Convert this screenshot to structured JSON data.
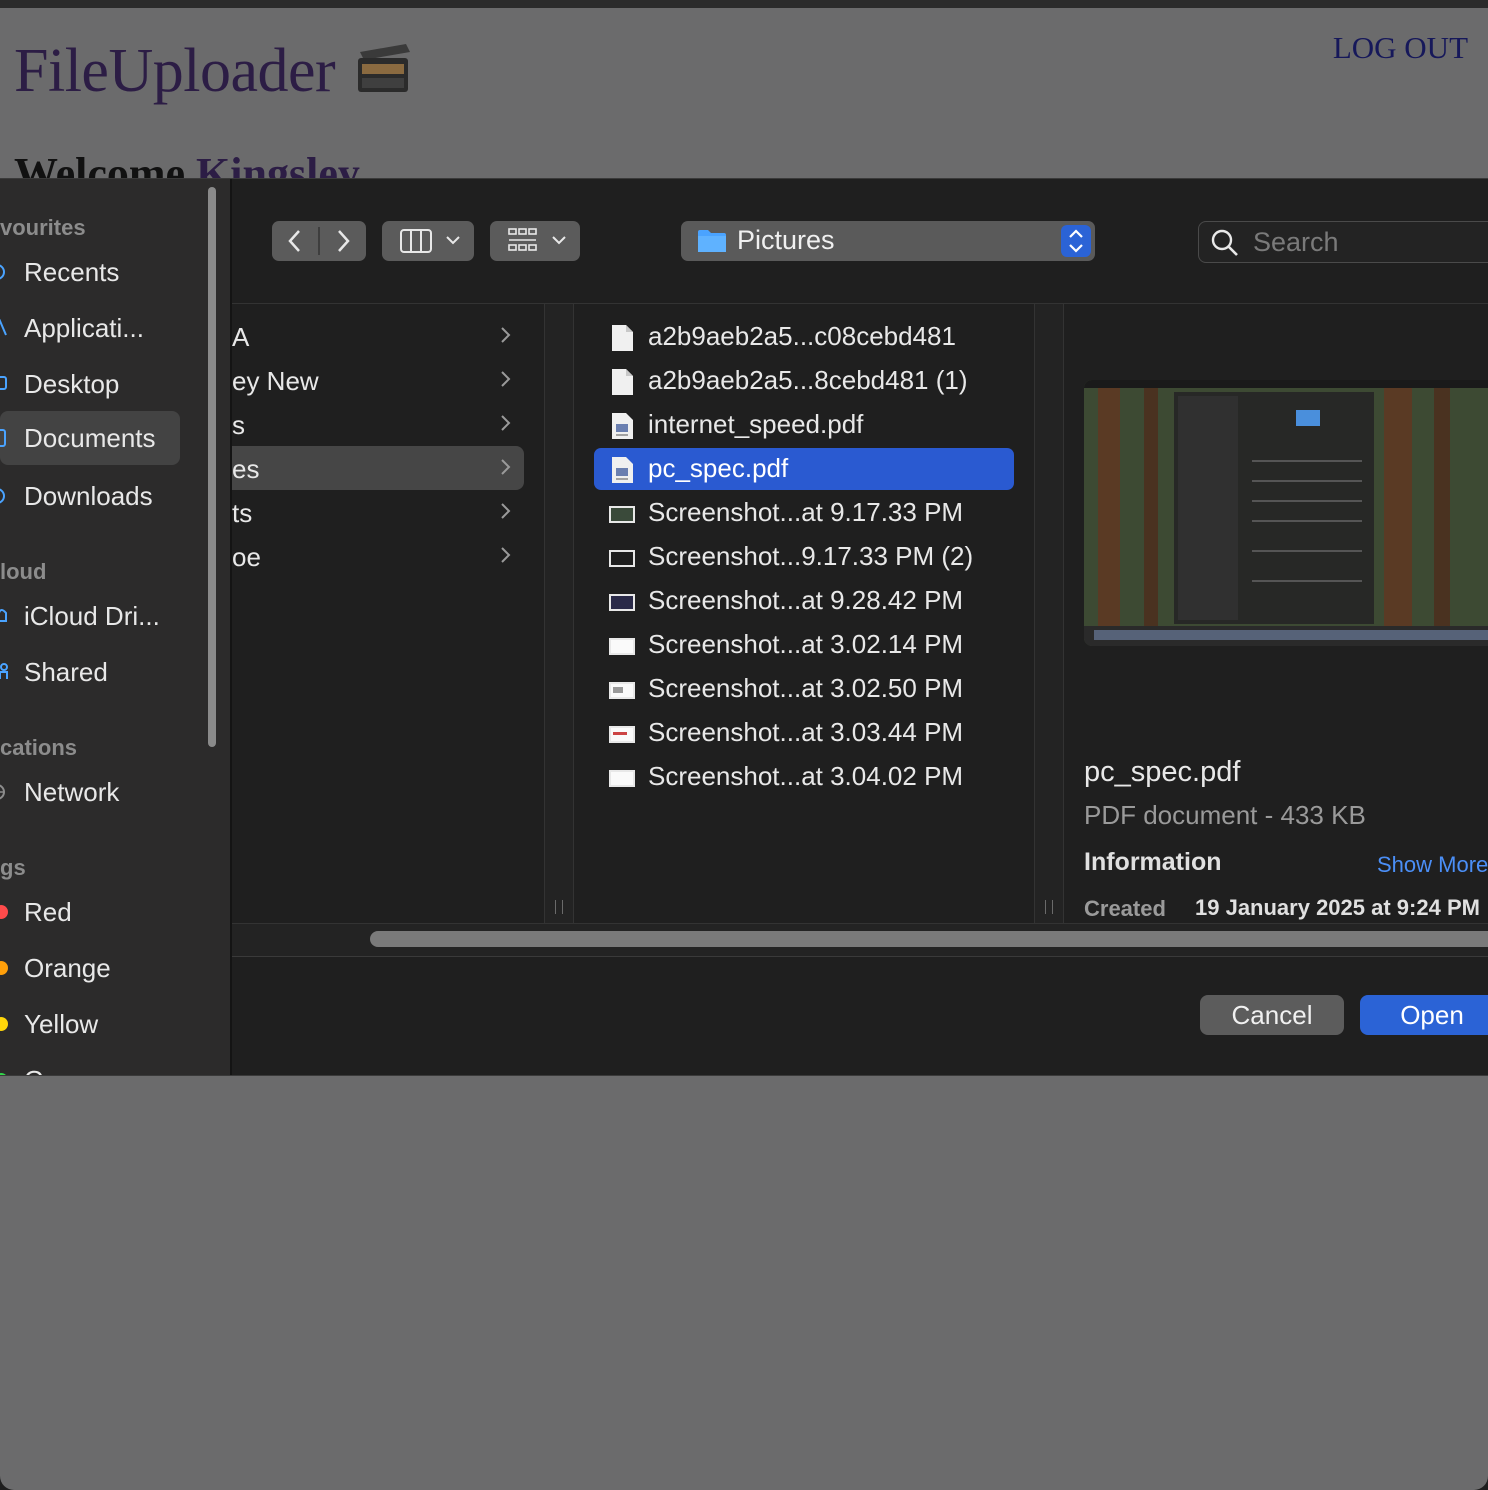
{
  "app": {
    "logo_text": "FileUploader",
    "logout_label": "LOG OUT",
    "welcome_prefix": "Welcome",
    "welcome_name": "Kingsley"
  },
  "sidebar": {
    "sections": [
      {
        "label": "vourites"
      },
      {
        "label": "loud"
      },
      {
        "label": "cations"
      },
      {
        "label": "gs"
      }
    ],
    "favourites": [
      {
        "label": "Recents",
        "icon": "clock-icon"
      },
      {
        "label": "Applicati...",
        "icon": "applications-icon"
      },
      {
        "label": "Desktop",
        "icon": "desktop-icon"
      },
      {
        "label": "Documents",
        "icon": "document-icon",
        "selected": true
      },
      {
        "label": "Downloads",
        "icon": "download-icon"
      }
    ],
    "icloud": [
      {
        "label": "iCloud Dri...",
        "icon": "cloud-icon"
      },
      {
        "label": "Shared",
        "icon": "shared-folder-icon"
      }
    ],
    "locations": [
      {
        "label": "Network",
        "icon": "globe-icon"
      }
    ],
    "tags": [
      {
        "label": "Red",
        "color": "#ff4b4b"
      },
      {
        "label": "Orange",
        "color": "#ff9f0a"
      },
      {
        "label": "Yellow",
        "color": "#ffd60a"
      },
      {
        "label": "Green",
        "color": "#32d74b"
      }
    ]
  },
  "toolbar": {
    "path_label": "Pictures",
    "search_placeholder": "Search"
  },
  "column1": {
    "items": [
      {
        "label": "A"
      },
      {
        "label": "ey New"
      },
      {
        "label": "s"
      },
      {
        "label": "es",
        "selected": true
      },
      {
        "label": "ts"
      },
      {
        "label": "oe"
      }
    ]
  },
  "files": [
    {
      "name": "a2b9aeb2a5...c08cebd481",
      "icon": "blank-file-icon"
    },
    {
      "name": "a2b9aeb2a5...8cebd481 (1)",
      "icon": "blank-file-icon"
    },
    {
      "name": "internet_speed.pdf",
      "icon": "pdf-file-icon"
    },
    {
      "name": "pc_spec.pdf",
      "icon": "pdf-file-icon",
      "selected": true
    },
    {
      "name": "Screenshot...at 9.17.33 PM",
      "icon": "screenshot-thumb-icon"
    },
    {
      "name": "Screenshot...9.17.33 PM (2)",
      "icon": "screenshot-thumb-icon"
    },
    {
      "name": "Screenshot...at 9.28.42 PM",
      "icon": "screenshot-thumb-icon"
    },
    {
      "name": "Screenshot...at 3.02.14 PM",
      "icon": "screenshot-thumb-icon"
    },
    {
      "name": "Screenshot...at 3.02.50 PM",
      "icon": "screenshot-thumb-icon"
    },
    {
      "name": "Screenshot...at 3.03.44 PM",
      "icon": "screenshot-thumb-icon"
    },
    {
      "name": "Screenshot...at 3.04.02 PM",
      "icon": "screenshot-thumb-icon"
    }
  ],
  "preview": {
    "name": "pc_spec.pdf",
    "kind": "PDF document - 433 KB",
    "info_heading": "Information",
    "show_more": "Show More",
    "created_label": "Created",
    "created_value": "19 January 2025 at 9:24 PM"
  },
  "buttons": {
    "cancel": "Cancel",
    "open": "Open"
  }
}
